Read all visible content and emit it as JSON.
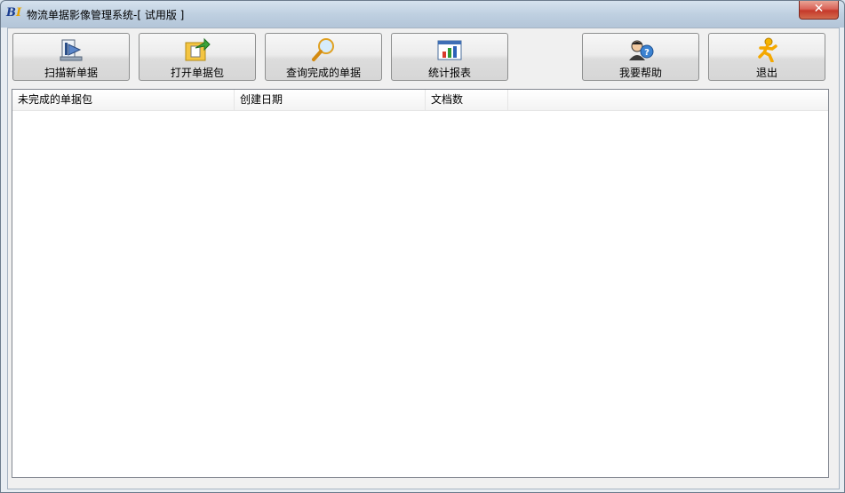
{
  "window": {
    "title": "物流单据影像管理系统-[ 试用版 ]",
    "logo_text": "B",
    "logo_text2": "I",
    "close_glyph": "✕"
  },
  "toolbar": {
    "buttons": [
      {
        "label": "扫描新单据",
        "icon": "scanner-icon"
      },
      {
        "label": "打开单据包",
        "icon": "open-folder-icon"
      },
      {
        "label": "查询完成的单据",
        "icon": "magnifier-icon"
      },
      {
        "label": "统计报表",
        "icon": "bar-chart-icon"
      },
      {
        "label": "我要帮助",
        "icon": "help-user-icon"
      },
      {
        "label": "退出",
        "icon": "exit-running-man-icon"
      }
    ]
  },
  "list": {
    "columns": [
      "未完成的单据包",
      "创建日期",
      "文档数"
    ],
    "rows": []
  },
  "colors": {
    "titlebar": "#bfd0e1",
    "close_button": "#c5392a",
    "button_face": "#e4e4e4",
    "list_background": "#ffffff"
  }
}
